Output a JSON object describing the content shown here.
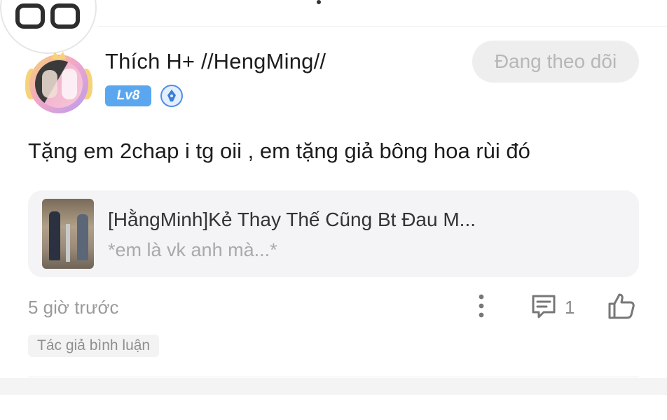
{
  "user": {
    "name": "Thích H+ //HengMing//",
    "level": "Lv8"
  },
  "follow_button": {
    "label": "Đang theo dõi"
  },
  "comment": {
    "text": "Tặng em 2chap i tg oii , em tặng giả bông hoa rùi đó",
    "time": "5 giờ trước",
    "reply_count": "1",
    "author_tag": "Tác giả bình luận"
  },
  "story": {
    "title": "[HằngMinh]Kẻ Thay Thế Cũng Bt Đau M...",
    "subtitle": "*em là vk anh mà...*"
  },
  "colors": {
    "level_badge": "#5aa7ef",
    "follow_button_bg": "#eeeeee",
    "follow_button_text": "#b7b7b7",
    "card_bg": "#f4f4f6",
    "muted_text": "#9a9a9a"
  },
  "icons": [
    "app-logo-icon",
    "pen-badge-icon",
    "more-vertical-icon",
    "comment-icon",
    "like-icon"
  ]
}
